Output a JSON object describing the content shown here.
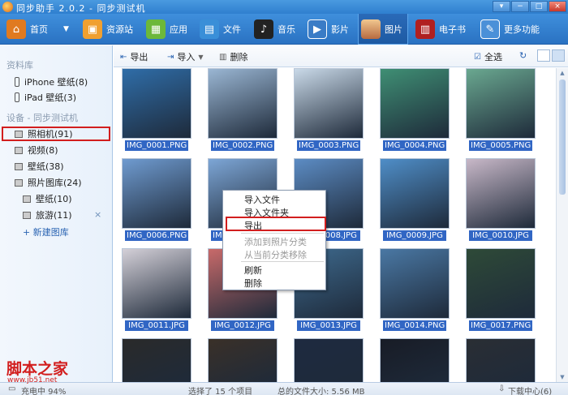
{
  "app": {
    "title": "同步助手 2.0.2 - 同步测试机"
  },
  "window_controls": [
    "▾",
    "−",
    "□",
    "×"
  ],
  "nav": {
    "items": [
      {
        "label": "首页",
        "icon": "home-icon",
        "color": "#e07a20"
      },
      {
        "label": "资源站",
        "icon": "bag-icon",
        "color": "#f0a030"
      },
      {
        "label": "应用",
        "icon": "apps-icon",
        "color": "#6cb83a"
      },
      {
        "label": "文件",
        "icon": "folder-icon",
        "color": "#3a8fd8"
      },
      {
        "label": "音乐",
        "icon": "music-icon",
        "color": "#222222"
      },
      {
        "label": "影片",
        "icon": "video-icon",
        "color": "#3a7cc6"
      },
      {
        "label": "图片",
        "icon": "picture-icon",
        "color": "#d8a070"
      },
      {
        "label": "电子书",
        "icon": "book-icon",
        "color": "#b02020"
      },
      {
        "label": "更多功能",
        "icon": "tools-icon",
        "color": "#4a90d8"
      }
    ],
    "active": "图片"
  },
  "sidebar": {
    "library_header": "资料库",
    "library_items": [
      "iPhone 壁纸(8)",
      "iPad 壁纸(3)"
    ],
    "device_header": "设备 - 同步测试机",
    "device_items": [
      "照相机(91)",
      "视频(8)",
      "壁纸(38)",
      "照片图库(24)"
    ],
    "album_items": [
      "壁纸(10)",
      "旅游(11)"
    ],
    "remove_symbol": "×",
    "new_album": "+ 新建图库"
  },
  "toolbar": {
    "export": "导出",
    "import": "导入",
    "delete": "删除",
    "select_all": "全选"
  },
  "photos": [
    "IMG_0001.PNG",
    "IMG_0002.PNG",
    "IMG_0003.PNG",
    "IMG_0004.PNG",
    "IMG_0005.PNG",
    "IMG_0006.PNG",
    "IMG_0007.PNG",
    "IMG_0008.JPG",
    "IMG_0009.JPG",
    "IMG_0010.JPG",
    "IMG_0011.JPG",
    "IMG_0012.JPG",
    "IMG_0013.JPG",
    "IMG_0014.PNG",
    "IMG_0017.PNG",
    "",
    "",
    "",
    "",
    ""
  ],
  "thumb_colors": [
    "#2f6da8",
    "#9ab6d3",
    "#c9d9e8",
    "#3f8f74",
    "#6aa890",
    "#6f9bd0",
    "#7da6d6",
    "#5c8cc4",
    "#4f8ec8",
    "#c8b8c8",
    "#d4d0d8",
    "#c86a6a",
    "#3e6a8e",
    "#4a78a4",
    "#2e4a38",
    "#2a2a2a",
    "#3a3028",
    "#1e2a40",
    "#181c26",
    "#2a2e34"
  ],
  "context_menu": {
    "items": [
      {
        "label": "导入文件",
        "disabled": false
      },
      {
        "label": "导入文件夹",
        "disabled": false
      },
      {
        "label": "导出",
        "disabled": false
      },
      {
        "label": "添加到照片分类",
        "disabled": true
      },
      {
        "label": "从当前分类移除",
        "disabled": true
      },
      {
        "label": "刷新",
        "disabled": false
      },
      {
        "label": "删除",
        "disabled": false
      }
    ]
  },
  "status": {
    "charging": "充电中 94%",
    "selected": "选择了 15 个项目",
    "total_size": "总的文件大小: 5.56 MB",
    "download_center": "下载中心(6)"
  },
  "watermark": {
    "line1": "脚本之家",
    "line2": "www.jb51.net"
  }
}
